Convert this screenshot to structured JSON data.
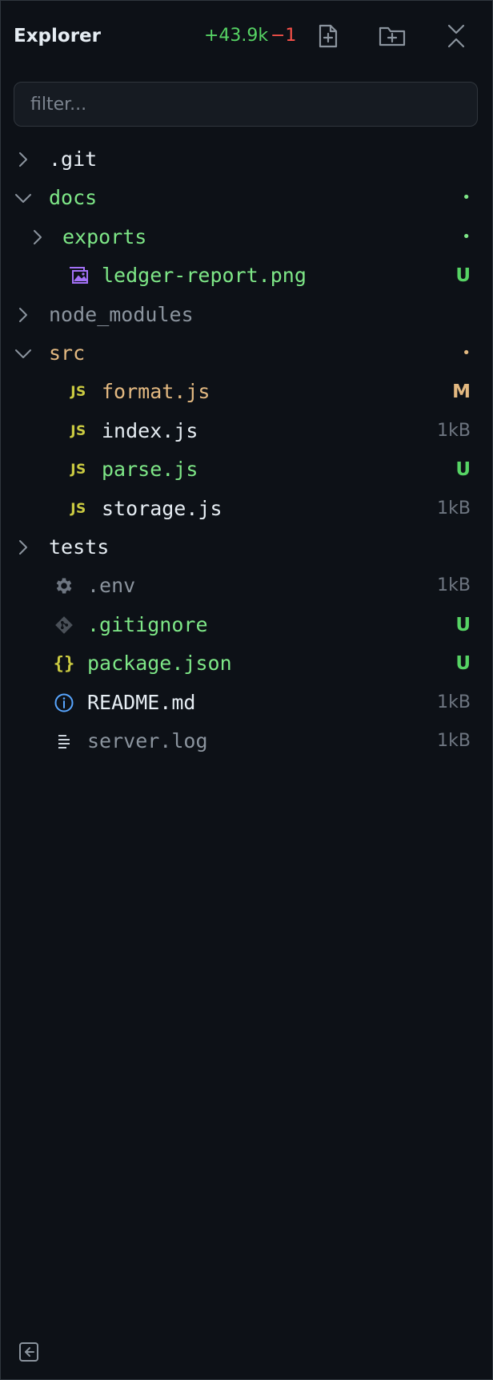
{
  "header": {
    "title": "Explorer",
    "additions": "+43.9k",
    "deletions": "−1",
    "new_file_icon": "file-plus-icon",
    "new_folder_icon": "folder-plus-icon",
    "collapse_icon": "collapse-all-icon"
  },
  "filter": {
    "placeholder": "filter...",
    "value": ""
  },
  "tree": {
    "items": [
      {
        "label": ".git",
        "kind": "folder",
        "expanded": false,
        "depth": 0,
        "meta": "",
        "color": "#e6edf3"
      },
      {
        "label": "docs",
        "kind": "folder",
        "expanded": true,
        "depth": 0,
        "meta": "•",
        "color": "#7ee787"
      },
      {
        "label": "exports",
        "kind": "folder",
        "expanded": false,
        "depth": 1,
        "meta": "•",
        "color": "#7ee787"
      },
      {
        "label": "ledger-report.png",
        "kind": "file",
        "icon": "image-icon",
        "depth": 2,
        "meta": "U",
        "color": "#7ee787"
      },
      {
        "label": "node_modules",
        "kind": "folder",
        "expanded": false,
        "depth": 0,
        "meta": "",
        "color": "#8b949e"
      },
      {
        "label": "src",
        "kind": "folder",
        "expanded": true,
        "depth": 0,
        "meta": "•",
        "color": "#e3b981"
      },
      {
        "label": "format.js",
        "kind": "file",
        "icon": "js-icon",
        "depth": 1,
        "meta": "M",
        "color": "#e3b981"
      },
      {
        "label": "index.js",
        "kind": "file",
        "icon": "js-icon",
        "depth": 1,
        "meta": "1kB",
        "color": "#e6edf3"
      },
      {
        "label": "parse.js",
        "kind": "file",
        "icon": "js-icon",
        "depth": 1,
        "meta": "U",
        "color": "#7ee787"
      },
      {
        "label": "storage.js",
        "kind": "file",
        "icon": "js-icon",
        "depth": 1,
        "meta": "1kB",
        "color": "#e6edf3"
      },
      {
        "label": "tests",
        "kind": "folder",
        "expanded": false,
        "depth": 0,
        "meta": "",
        "color": "#e6edf3"
      },
      {
        "label": ".env",
        "kind": "file",
        "icon": "gear-icon",
        "depth": 0,
        "meta": "1kB",
        "color": "#8b949e"
      },
      {
        "label": ".gitignore",
        "kind": "file",
        "icon": "git-icon",
        "depth": 0,
        "meta": "U",
        "color": "#7ee787"
      },
      {
        "label": "package.json",
        "kind": "file",
        "icon": "braces-icon",
        "depth": 0,
        "meta": "U",
        "color": "#7ee787"
      },
      {
        "label": "README.md",
        "kind": "file",
        "icon": "info-icon",
        "depth": 0,
        "meta": "1kB",
        "color": "#e6edf3"
      },
      {
        "label": "server.log",
        "kind": "file",
        "icon": "lines-icon",
        "depth": 0,
        "meta": "1kB",
        "color": "#8b949e"
      }
    ]
  },
  "footer": {
    "collapse_sidebar_icon": "sidebar-collapse-icon"
  },
  "colors": {
    "background": "#0d1117",
    "border": "#30363d",
    "added": "#7ee787",
    "modified": "#e3b981",
    "untracked_badge": "#56d364",
    "deleted": "#f85149",
    "dim": "#8b949e",
    "js": "#cbcb41",
    "image": "#a371f7",
    "info": "#58a6ff"
  }
}
